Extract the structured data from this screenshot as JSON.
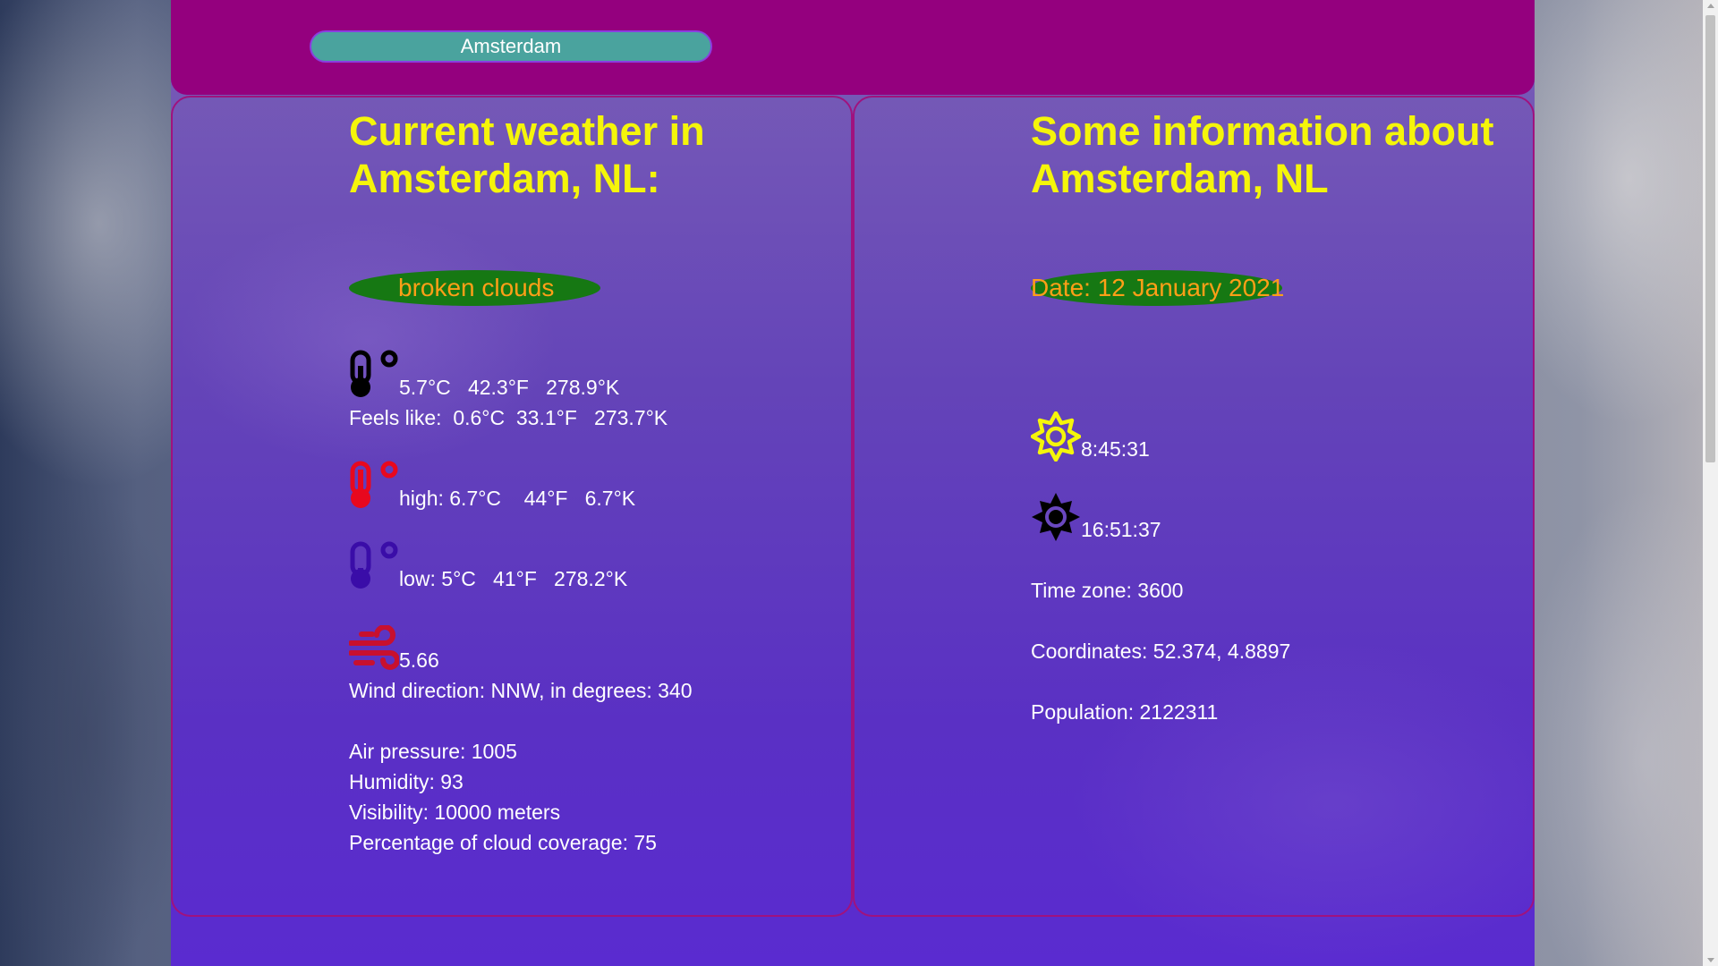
{
  "search": {
    "value": "Amsterdam"
  },
  "weather": {
    "heading": "Current weather in Amsterdam, NL:",
    "description": "broken clouds",
    "temp": "5.7°C   42.3°F   278.9°K",
    "feels_like": "Feels like:  0.6°C  33.1°F   273.7°K",
    "high": "high: 6.7°C    44°F   6.7°K",
    "low": "low: 5°C   41°F   278.2°K",
    "wind_speed": "5.66",
    "wind_direction": "Wind direction: NNW, in degrees: 340",
    "air_pressure": "Air pressure: 1005",
    "humidity": "Humidity: 93",
    "visibility": "Visibility: 10000 meters",
    "cloud_coverage": "Percentage of cloud coverage: 75"
  },
  "info": {
    "heading": "Some information about Amsterdam, NL",
    "date": "Date: 12 January 2021",
    "sunrise": "8:45:31",
    "sunset": "16:51:37",
    "timezone": "Time zone: 3600",
    "coordinates": "Coordinates: 52.374, 4.8897",
    "population": "Population: 2122311"
  },
  "icons": {
    "temp": "thermometer-icon",
    "high": "thermometer-hot-icon",
    "low": "thermometer-cold-icon",
    "wind": "wind-icon",
    "sunrise": "sunrise-icon",
    "sunset": "sunset-icon"
  },
  "colors": {
    "topbar": "#94007e",
    "heading": "#f5f50a",
    "pill_bg": "#167813",
    "pill_text": "#ff9f17",
    "search_bg": "#4aa39e",
    "hot": "#e8081e",
    "cold": "#3a0da8",
    "wind": "#c8102e",
    "sunrise": "#f5f50a"
  }
}
